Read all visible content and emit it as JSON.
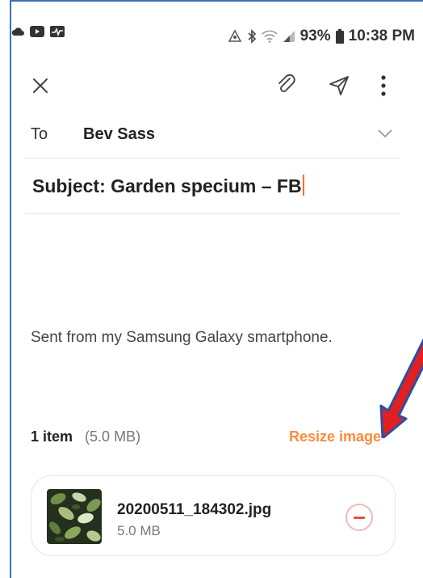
{
  "status_bar": {
    "battery_percent": "93%",
    "time": "10:38 PM",
    "left_icons": [
      "cloud-icon",
      "youtube-icon",
      "activity-icon"
    ],
    "right_icons": [
      "accessibility-icon",
      "bluetooth-icon",
      "wifi-icon",
      "signal-icon",
      "battery-icon"
    ]
  },
  "toolbar": {
    "close_icon": "close-icon",
    "attach_icon": "paperclip-icon",
    "send_icon": "send-icon",
    "more_icon": "more-vert-icon"
  },
  "recipient": {
    "label": "To",
    "value": "Bev Sass"
  },
  "subject": {
    "value": "Subject: Garden specium – FB"
  },
  "body": {
    "signature": "Sent from my Samsung Galaxy smartphone."
  },
  "attachments": {
    "count_label": "1 item",
    "total_size": "(5.0 MB)",
    "resize_label": "Resize image",
    "items": [
      {
        "file_name": "20200511_184302.jpg",
        "file_size": "5.0 MB"
      }
    ]
  },
  "colors": {
    "accent": "#ff8a3c",
    "caret": "#ff6d2e",
    "remove": "#ea4a4a",
    "annotation_arrow": "#e02020",
    "annotation_outline": "#2c4ea8"
  }
}
